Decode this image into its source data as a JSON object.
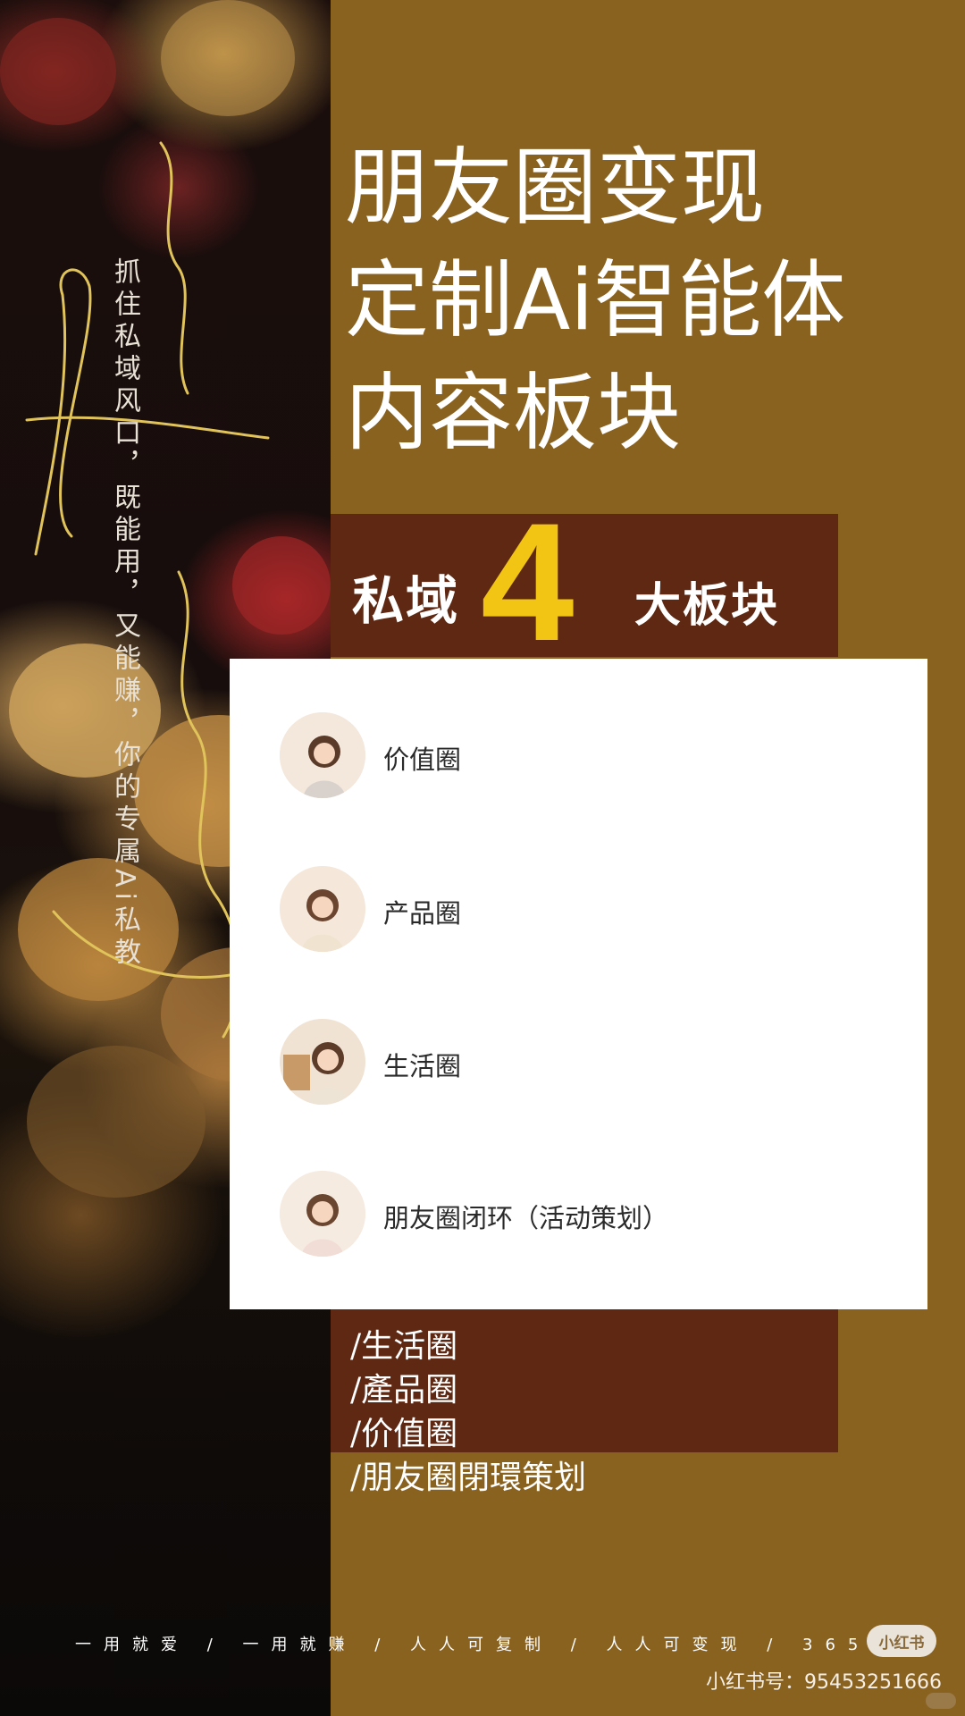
{
  "photo_text": "抓住私域风口，既能用，又能赚，你的专属Ai私教",
  "title_lines": [
    "朋友圈变现",
    "定制Ai智能体",
    "内容板块"
  ],
  "banner": {
    "prefix": "私域",
    "number": "4",
    "suffix": "大板块"
  },
  "items": [
    {
      "label": "价值圈",
      "avatar_icon": "avatar-value-icon"
    },
    {
      "label": "产品圈",
      "avatar_icon": "avatar-product-icon"
    },
    {
      "label": "生活圈",
      "avatar_icon": "avatar-life-icon"
    },
    {
      "label": "朋友圈闭环（活动策划）",
      "avatar_icon": "avatar-loop-icon"
    }
  ],
  "list": [
    "/生活圈",
    "/產品圈",
    "/价值圈",
    "/朋友圈閉環策划"
  ],
  "footer": {
    "slogan": "一用就爱 / 一用就赚 / 人人可复制 / 人人可变现 / 365之",
    "badge": "小红书",
    "id": "小红书号：95453251666"
  },
  "colors": {
    "background": "#8a6220",
    "banner": "#5e2813",
    "accent": "#f2c413"
  }
}
